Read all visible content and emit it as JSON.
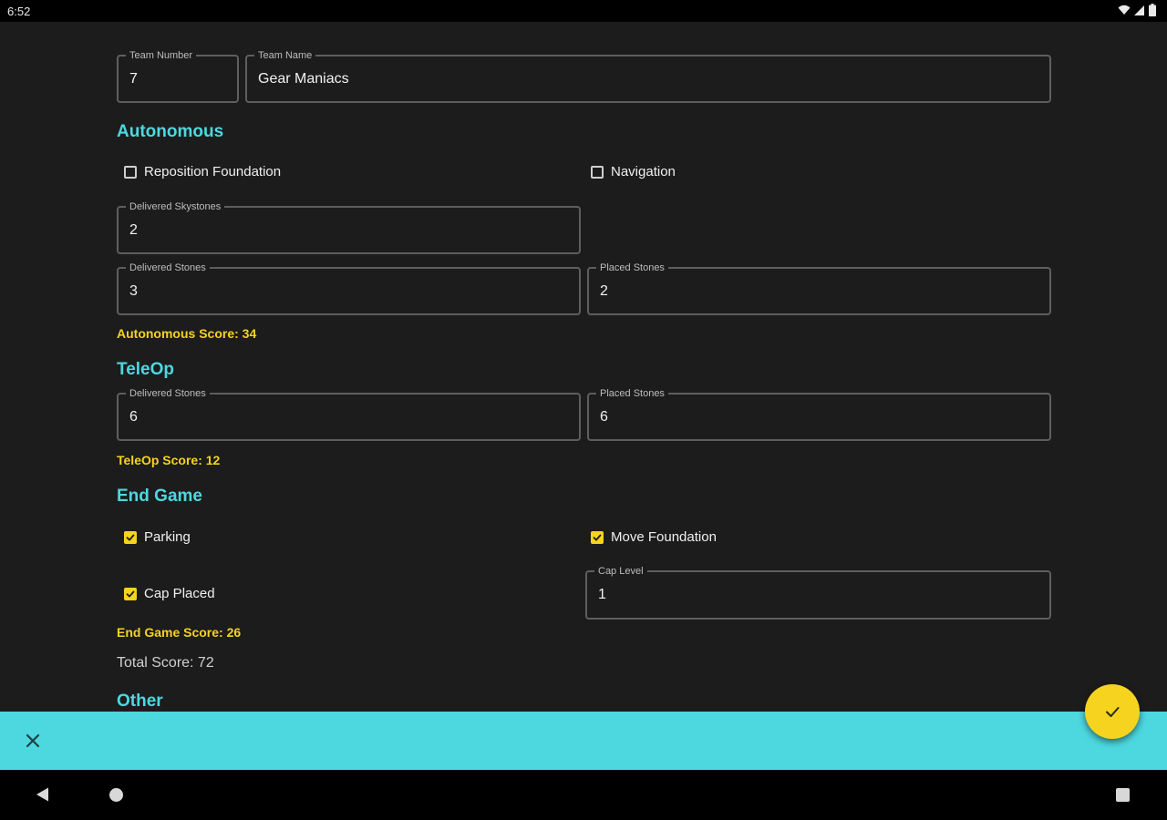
{
  "status_bar": {
    "time": "6:52"
  },
  "team": {
    "number_label": "Team Number",
    "number_value": "7",
    "name_label": "Team Name",
    "name_value": "Gear Maniacs"
  },
  "autonomous": {
    "title": "Autonomous",
    "reposition_foundation": {
      "label": "Reposition Foundation",
      "checked": false
    },
    "navigation": {
      "label": "Navigation",
      "checked": false
    },
    "delivered_skystones_label": "Delivered Skystones",
    "delivered_skystones_value": "2",
    "delivered_stones_label": "Delivered Stones",
    "delivered_stones_value": "3",
    "placed_stones_label": "Placed Stones",
    "placed_stones_value": "2",
    "score_text": "Autonomous Score: 34"
  },
  "teleop": {
    "title": "TeleOp",
    "delivered_stones_label": "Delivered Stones",
    "delivered_stones_value": "6",
    "placed_stones_label": "Placed Stones",
    "placed_stones_value": "6",
    "score_text": "TeleOp Score: 12"
  },
  "endgame": {
    "title": "End Game",
    "parking": {
      "label": "Parking",
      "checked": true
    },
    "move_foundation": {
      "label": "Move Foundation",
      "checked": true
    },
    "cap_placed": {
      "label": "Cap Placed",
      "checked": true
    },
    "cap_level_label": "Cap Level",
    "cap_level_value": "1",
    "score_text": "End Game Score: 26"
  },
  "total_score_text": "Total Score: 72",
  "other": {
    "title": "Other"
  },
  "colors": {
    "accent_cyan": "#4dd8e0",
    "accent_yellow": "#f5d31f",
    "background": "#1c1c1c"
  },
  "icons": {
    "close": "close-icon",
    "confirm": "check-icon"
  }
}
